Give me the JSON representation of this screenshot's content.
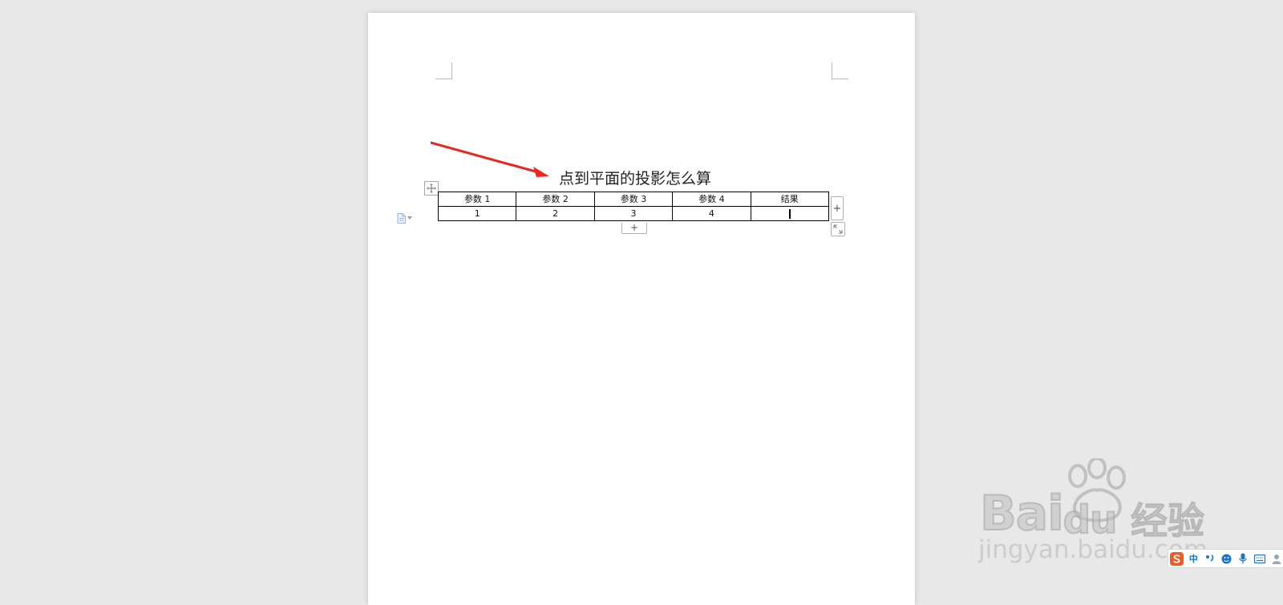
{
  "document": {
    "title": "点到平面的投影怎么算"
  },
  "table": {
    "headers": [
      "参数 1",
      "参数 2",
      "参数 3",
      "参数 4",
      "结果"
    ],
    "rows": [
      [
        "1",
        "2",
        "3",
        "4",
        ""
      ]
    ]
  },
  "controls": {
    "add_column_symbol": "+",
    "add_row_symbol": "+"
  },
  "watermark": {
    "brand": "Bai",
    "brand_tail": "du",
    "brand_cn": "经验",
    "url": "jingyan.baidu.com"
  },
  "ime": {
    "logo_icon": "sogou-s-icon",
    "mode_label": "中",
    "icons": [
      "punctuation-icon",
      "emoji-icon",
      "microphone-icon",
      "keyboard-icon",
      "user-icon"
    ]
  },
  "colors": {
    "annotation_arrow": "#e8271f",
    "background": "#e8e8e8",
    "page": "#ffffff",
    "ime_accent": "#1a73c8",
    "sogou_logo": "#f15a24"
  }
}
